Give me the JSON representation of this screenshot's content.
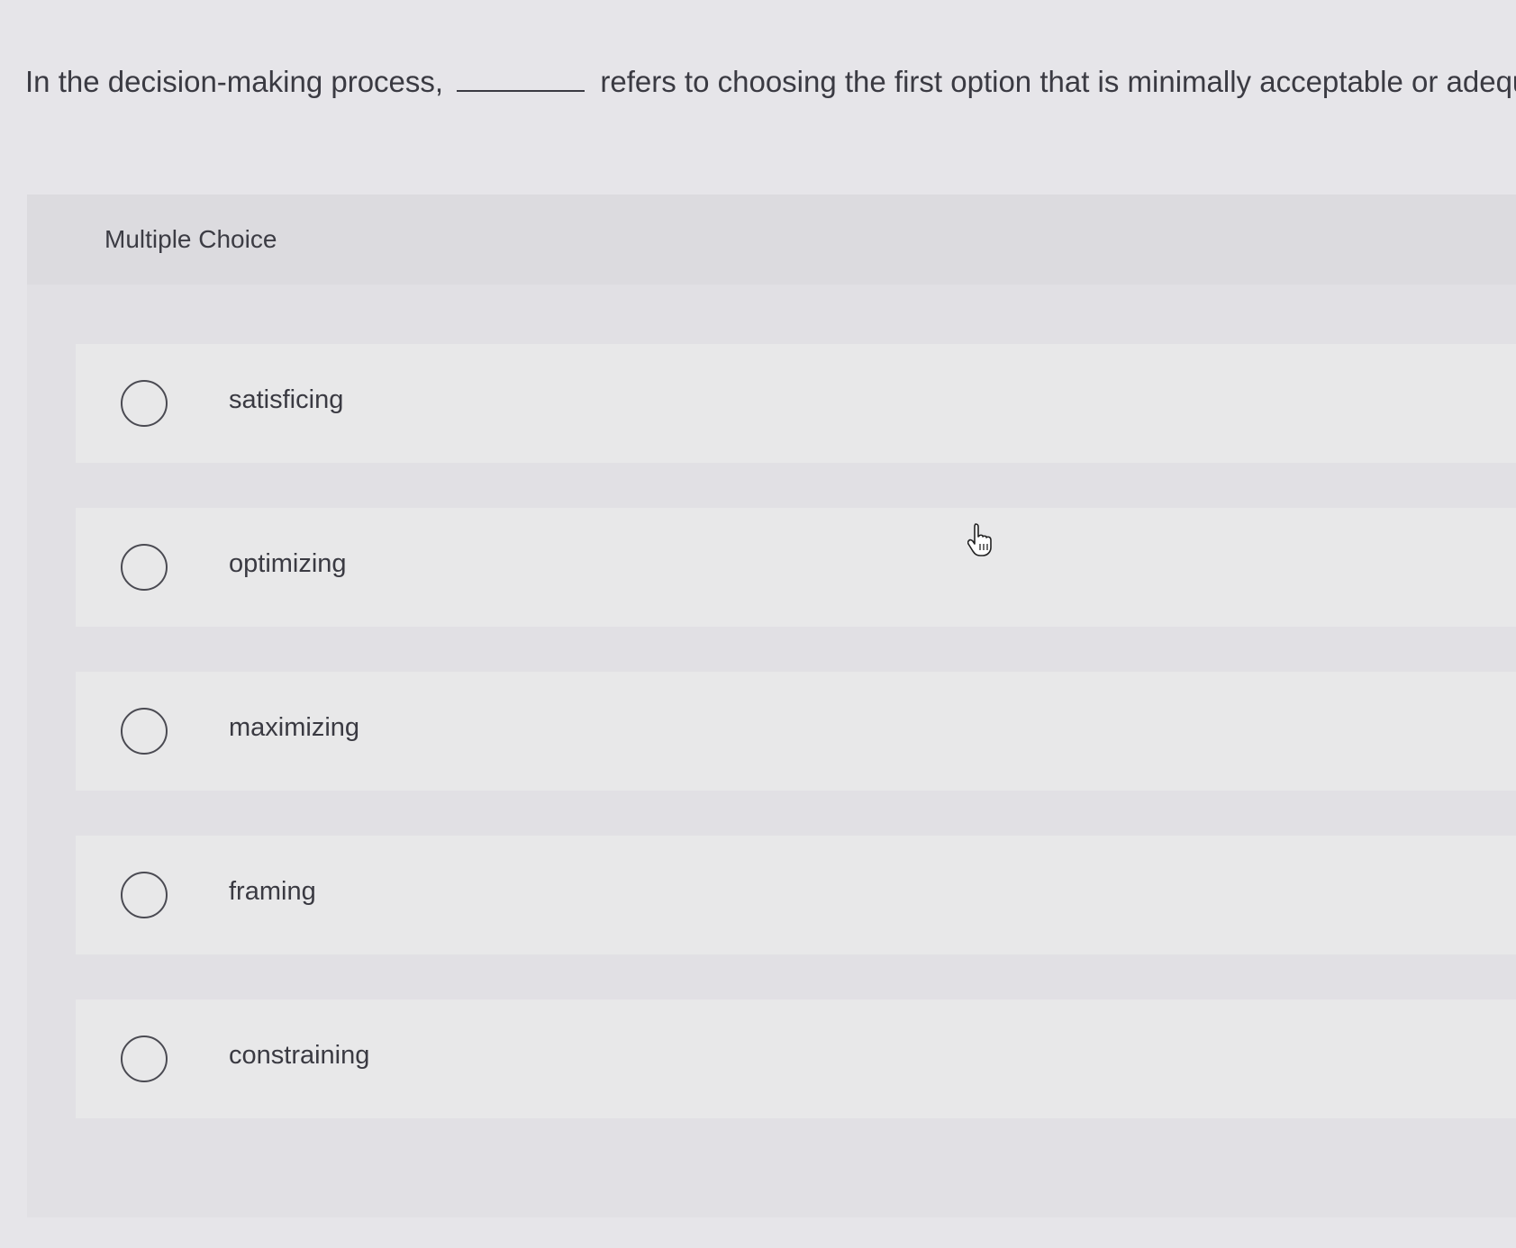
{
  "question": {
    "before_blank": "In the decision-making process,",
    "after_blank": "refers to choosing the first option that is minimally acceptable or adequate."
  },
  "section": {
    "label": "Multiple Choice"
  },
  "options": [
    {
      "label": "satisficing"
    },
    {
      "label": "optimizing"
    },
    {
      "label": "maximizing"
    },
    {
      "label": "framing"
    },
    {
      "label": "constraining"
    }
  ],
  "icons": {
    "cursor": "hand-pointer-icon",
    "radio": "radio-unselected-icon"
  }
}
